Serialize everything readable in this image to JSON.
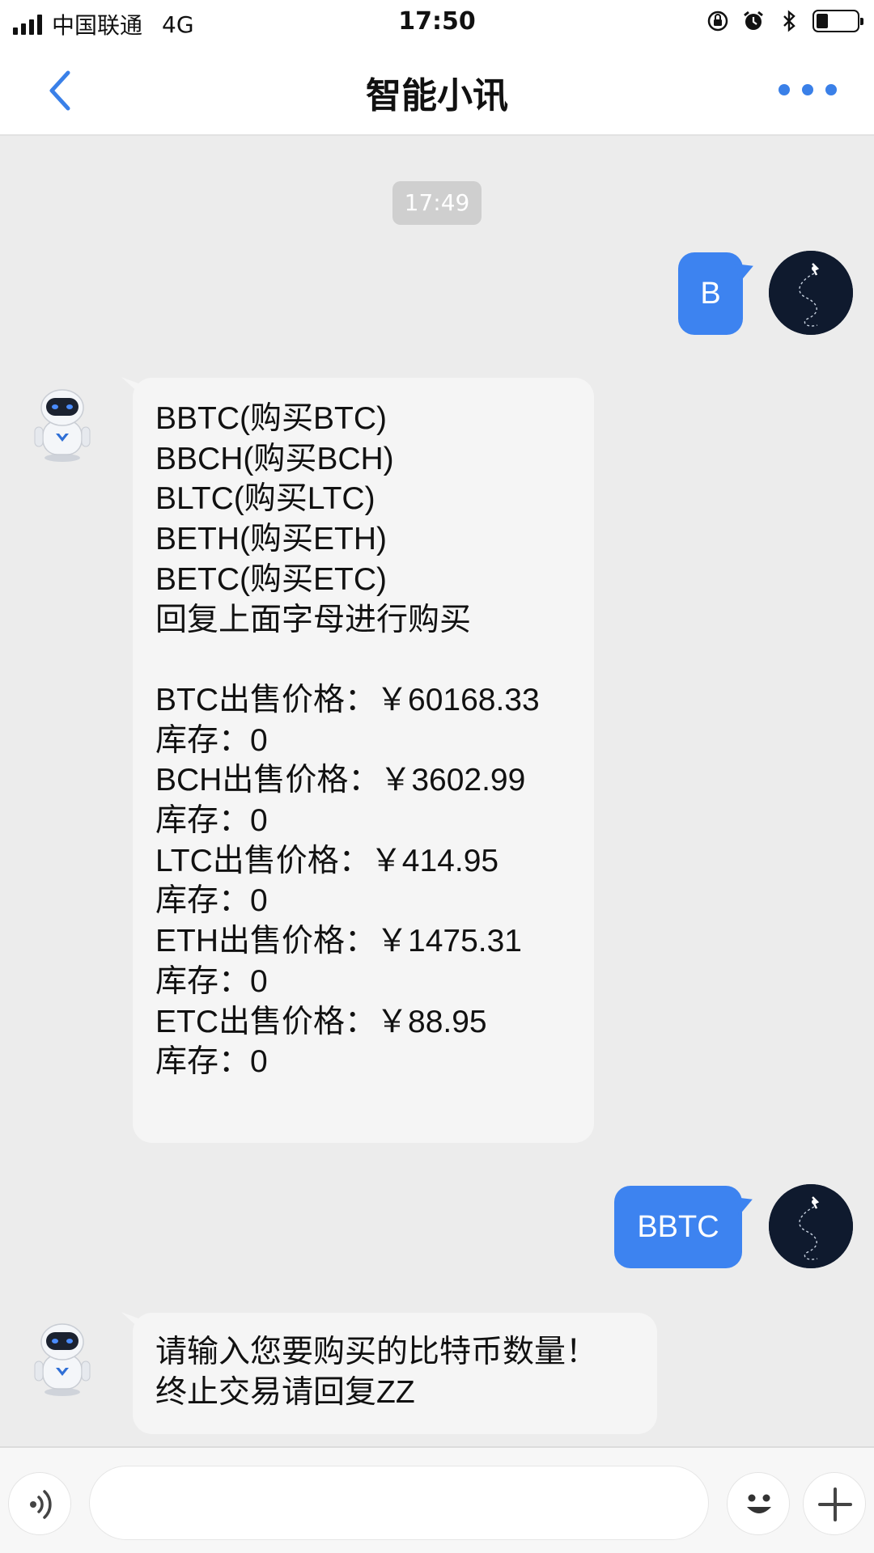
{
  "status_bar": {
    "carrier": "中国联通",
    "network": "4G",
    "time": "17:50",
    "icons": [
      "orientation-lock-icon",
      "alarm-icon",
      "bluetooth-icon",
      "battery-icon"
    ],
    "battery_level": 0.3
  },
  "nav": {
    "title": "智能小讯",
    "back_icon": "chevron-left-icon",
    "more_icon": "more-dots-icon"
  },
  "chat": {
    "timestamp": "17:49",
    "messages": [
      {
        "sender": "user",
        "text": "B"
      },
      {
        "sender": "bot",
        "lines": [
          "BBTC(购买BTC)",
          "BBCH(购买BCH)",
          "BLTC(购买LTC)",
          "BETH(购买ETH)",
          "BETC(购买ETC)",
          "回复上面字母进行购买",
          "",
          "BTC出售价格：￥60168.33",
          "库存：0",
          "BCH出售价格：￥3602.99",
          "库存：0",
          "LTC出售价格：￥414.95",
          "库存：0",
          "ETH出售价格：￥1475.31",
          "库存：0",
          "ETC出售价格：￥88.95",
          "库存：0"
        ]
      },
      {
        "sender": "user",
        "text": "BBTC"
      },
      {
        "sender": "bot",
        "lines": [
          "请输入您要购买的比特币数量！",
          "终止交易请回复ZZ"
        ]
      }
    ]
  },
  "input_bar": {
    "voice_icon": "voice-icon",
    "emoji_icon": "emoji-icon",
    "plus_icon": "plus-icon",
    "placeholder": ""
  },
  "colors": {
    "accent": "#3d83f0",
    "chat_bg": "#ececec",
    "bot_bubble": "#f5f5f5"
  }
}
